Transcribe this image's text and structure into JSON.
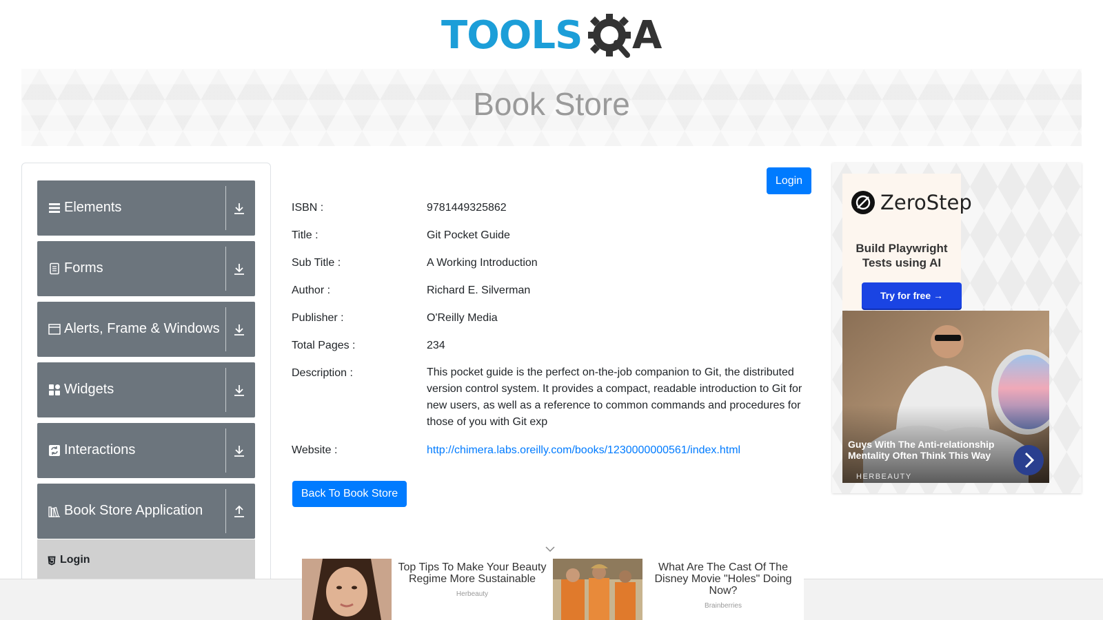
{
  "header": {
    "logo_text": "TOOLS",
    "logo_suffix": "A",
    "banner_title": "Book Store"
  },
  "sidebar": {
    "groups": [
      {
        "label": "Elements",
        "icon": "list-icon",
        "toggle": "expand"
      },
      {
        "label": "Forms",
        "icon": "form-icon",
        "toggle": "expand"
      },
      {
        "label": "Alerts, Frame & Windows",
        "icon": "window-icon",
        "toggle": "expand"
      },
      {
        "label": "Widgets",
        "icon": "widgets-icon",
        "toggle": "expand"
      },
      {
        "label": "Interactions",
        "icon": "interactions-icon",
        "toggle": "expand"
      },
      {
        "label": "Book Store Application",
        "icon": "books-icon",
        "toggle": "collapse"
      }
    ],
    "sub_items": [
      {
        "label": "Login",
        "icon": "html5-icon",
        "active": true
      }
    ]
  },
  "book": {
    "login_label": "Login",
    "isbn_label": "ISBN :",
    "isbn": "9781449325862",
    "title_label": "Title :",
    "title": "Git Pocket Guide",
    "subtitle_label": "Sub Title :",
    "subtitle": "A Working Introduction",
    "author_label": "Author :",
    "author": "Richard E. Silverman",
    "publisher_label": "Publisher :",
    "publisher": "O'Reilly Media",
    "pages_label": "Total Pages :",
    "pages": "234",
    "description_label": "Description :",
    "description": "This pocket guide is the perfect on-the-job companion to Git, the distributed version control system. It provides a compact, readable introduction to Git for new users, as well as a reference to common commands and procedures for those of you with Git exp",
    "website_label": "Website :",
    "website": "http://chimera.labs.oreilly.com/books/1230000000561/index.html",
    "back_label": "Back To Book Store"
  },
  "ads": {
    "zerostep": {
      "name": "ZeroStep",
      "tagline_1": "Build Playwright",
      "tagline_2": "Tests using AI",
      "cta": "Try for free →",
      "brand_color": "#1a44e3"
    },
    "herbeauty_side": {
      "title": "Guys With The Anti-relationship Mentality Often Think This Way",
      "source": "HERBEAUTY"
    },
    "bottom": [
      {
        "title": "Top Tips To Make Your Beauty Regime More Sustainable",
        "source": "Herbeauty"
      },
      {
        "title": "What Are The Cast Of The Disney Movie \"Holes\" Doing Now?",
        "source": "Brainberries"
      }
    ]
  },
  "colors": {
    "primary": "#007bff",
    "sidebar_group": "#6c757d",
    "sidebar_active": "#d0d0d0",
    "logo_blue": "#1c9ed8"
  }
}
